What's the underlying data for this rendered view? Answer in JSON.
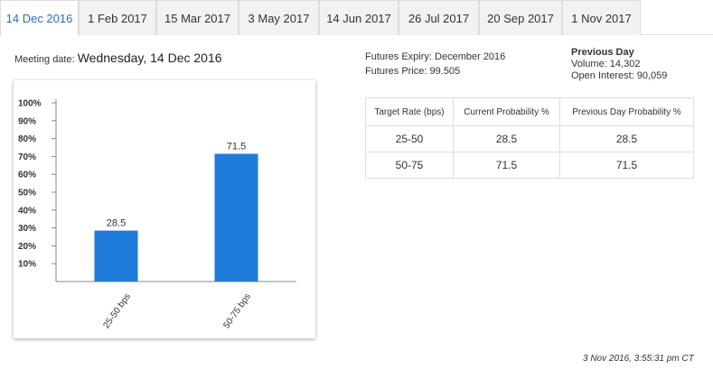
{
  "tabs": [
    {
      "label": "14 Dec 2016",
      "active": true
    },
    {
      "label": "1 Feb 2017",
      "active": false
    },
    {
      "label": "15 Mar 2017",
      "active": false
    },
    {
      "label": "3 May 2017",
      "active": false
    },
    {
      "label": "14 Jun 2017",
      "active": false
    },
    {
      "label": "26 Jul 2017",
      "active": false
    },
    {
      "label": "20 Sep 2017",
      "active": false
    },
    {
      "label": "1 Nov 2017",
      "active": false
    }
  ],
  "meeting": {
    "label": "Meeting date:",
    "value": "Wednesday, 14 Dec 2016"
  },
  "futures": {
    "expiry": "Futures Expiry: December 2016",
    "price": "Futures Price: 99.505"
  },
  "previous_day": {
    "title": "Previous Day",
    "volume": "Volume: 14,302",
    "open_interest": "Open Interest: 90,059"
  },
  "table": {
    "headers": [
      "Target Rate (bps)",
      "Current Probability %",
      "Previous Day Probability %"
    ],
    "rows": [
      [
        "25-50",
        "28.5",
        "28.5"
      ],
      [
        "50-75",
        "71.5",
        "71.5"
      ]
    ]
  },
  "timestamp": "3 Nov 2016, 3:55:31 pm CT",
  "colors": {
    "bar": "#1f7bd9",
    "active_tab_text": "#2a6ebb"
  },
  "chart_data": {
    "type": "bar",
    "categories": [
      "25-50 bps",
      "50-75 bps"
    ],
    "values": [
      28.5,
      71.5
    ],
    "ylim": [
      0,
      100
    ],
    "yticks": [
      "10%",
      "20%",
      "30%",
      "40%",
      "50%",
      "60%",
      "70%",
      "80%",
      "90%",
      "100%"
    ],
    "data_labels": [
      "28.5",
      "71.5"
    ],
    "grid": false,
    "legend": "none"
  }
}
